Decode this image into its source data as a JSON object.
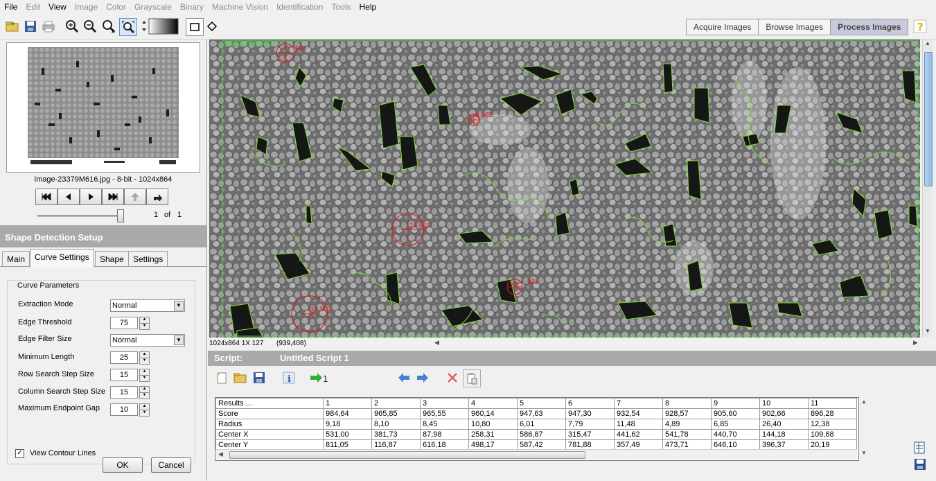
{
  "menu": [
    "File",
    "Edit",
    "View",
    "Image",
    "Color",
    "Grayscale",
    "Binary",
    "Machine Vision",
    "Identification",
    "Tools",
    "Help"
  ],
  "menu_disabled": [
    false,
    true,
    false,
    true,
    true,
    true,
    true,
    true,
    true,
    true,
    false
  ],
  "mode_tabs": [
    "Acquire Images",
    "Browse Images",
    "Process Images"
  ],
  "thumbnail": {
    "caption": "image-23379M616.jpg - 8-bit - 1024x864"
  },
  "navigator": {
    "current": "1",
    "of": "of",
    "total": "1"
  },
  "setup": {
    "title": "Shape Detection Setup",
    "tabs": [
      "Main",
      "Curve Settings",
      "Shape",
      "Settings"
    ],
    "group_title": "Curve Parameters",
    "fields": {
      "extraction_mode": {
        "label": "Extraction Mode",
        "value": "Normal"
      },
      "edge_threshold": {
        "label": "Edge Threshold",
        "value": "75"
      },
      "edge_filter_size": {
        "label": "Edge Filter Size",
        "value": "Normal"
      },
      "minimum_length": {
        "label": "Minimum Length",
        "value": "25"
      },
      "row_search_step": {
        "label": "Row Search Step Size",
        "value": "15"
      },
      "column_search_step": {
        "label": "Column Search Step Size",
        "value": "15"
      },
      "max_endpoint_gap": {
        "label": "Maximum Endpoint Gap",
        "value": "10"
      }
    },
    "view_contour_label": "View Contour Lines",
    "view_contour_checked": true,
    "ok_label": "OK",
    "cancel_label": "Cancel"
  },
  "image_view": {
    "roi_label": "Shape Detection 1",
    "detections": [
      {
        "label": "896"
      },
      {
        "label": "8 965"
      },
      {
        "label": "18 814"
      },
      {
        "label": "933"
      },
      {
        "label": "10 903"
      }
    ],
    "status": "1024x864 1X 127",
    "coords": "(939,408)"
  },
  "script": {
    "label": "Script:",
    "name": "Untitled Script 1"
  },
  "results": {
    "header": [
      "Results ...",
      "1",
      "2",
      "3",
      "4",
      "5",
      "6",
      "7",
      "8",
      "9",
      "10",
      "11"
    ],
    "rows": [
      [
        "Score",
        "984,64",
        "965,85",
        "965,55",
        "960,14",
        "947,63",
        "947,30",
        "932,54",
        "928,57",
        "905,60",
        "902,66",
        "896,28"
      ],
      [
        "Radius",
        "9,18",
        "8,10",
        "8,45",
        "10,80",
        "6,01",
        "7,79",
        "11,48",
        "4,89",
        "6,85",
        "26,40",
        "12,38"
      ],
      [
        "Center X",
        "531,00",
        "381,73",
        "87,98",
        "258,31",
        "586,87",
        "315,47",
        "441,62",
        "541,78",
        "440,70",
        "144,18",
        "109,68"
      ],
      [
        "Center Y",
        "811,05",
        "116,87",
        "616,18",
        "498,17",
        "587,42",
        "781,88",
        "357,49",
        "473,71",
        "646,10",
        "396,37",
        "20,19"
      ]
    ]
  },
  "colors": {
    "contour": "#7ddc3a",
    "detection": "#e0161e",
    "panel_header": "#a9a9a9"
  }
}
